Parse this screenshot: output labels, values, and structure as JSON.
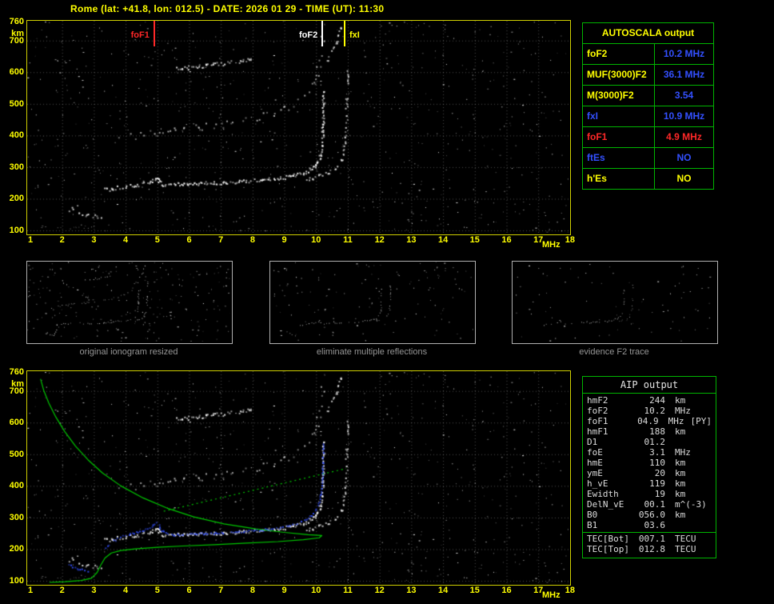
{
  "colors": {
    "yellow": "#ffff00",
    "green": "#00b400",
    "red": "#ff2828",
    "blue": "#3350ff",
    "white": "#ffffff"
  },
  "header": {
    "title": "Rome (lat: +41.8, lon: 012.5) - DATE: 2026 01 29 - TIME (UT): 11:30"
  },
  "top_plot": {
    "y_unit": "km",
    "x_unit": "MHz",
    "y_ticks": [
      760,
      700,
      600,
      500,
      400,
      300,
      200,
      100
    ],
    "x_ticks": [
      1,
      2,
      3,
      4,
      5,
      6,
      7,
      8,
      9,
      10,
      11,
      12,
      13,
      14,
      15,
      16,
      17,
      18
    ],
    "markers": [
      {
        "label": "foF1",
        "freq": 4.9,
        "color": "#ff2828",
        "side": "left"
      },
      {
        "label": "foF2",
        "freq": 10.2,
        "color": "#ffffff",
        "side": "left"
      },
      {
        "label": "fxI",
        "freq": 10.9,
        "color": "#ffff00",
        "side": "right"
      }
    ]
  },
  "bottom_plot": {
    "y_unit": "km",
    "x_unit": "MHz",
    "y_ticks": [
      760,
      700,
      600,
      500,
      400,
      300,
      200,
      100
    ],
    "x_ticks": [
      1,
      2,
      3,
      4,
      5,
      6,
      7,
      8,
      9,
      10,
      11,
      12,
      13,
      14,
      15,
      16,
      17,
      18
    ]
  },
  "autoscala_table": {
    "title": "AUTOSCALA output",
    "rows": [
      {
        "param": "foF2",
        "value": "10.2 MHz",
        "param_color": "yellow",
        "value_color": "blue"
      },
      {
        "param": "MUF(3000)F2",
        "value": "36.1 MHz",
        "param_color": "yellow",
        "value_color": "blue"
      },
      {
        "param": "M(3000)F2",
        "value": "3.54",
        "param_color": "yellow",
        "value_color": "blue"
      },
      {
        "param": "fxI",
        "value": "10.9 MHz",
        "param_color": "blue",
        "value_color": "blue"
      },
      {
        "param": "foF1",
        "value": "4.9 MHz",
        "param_color": "red",
        "value_color": "red"
      },
      {
        "param": "ftEs",
        "value": "NO",
        "param_color": "blue",
        "value_color": "blue"
      },
      {
        "param": "h'Es",
        "value": "NO",
        "param_color": "yellow",
        "value_color": "yellow"
      }
    ]
  },
  "thumbnails": [
    {
      "caption": "original ionogram resized"
    },
    {
      "caption": "eliminate multiple reflections"
    },
    {
      "caption": "evidence F2 trace"
    }
  ],
  "aip_table": {
    "title": "AIP output",
    "rows": [
      {
        "param": "hmF2",
        "value": "244",
        "unit": "km",
        "note": ""
      },
      {
        "param": "foF2",
        "value": "10.2",
        "unit": "MHz",
        "note": ""
      },
      {
        "param": "foF1",
        "value": "04.9",
        "unit": "MHz",
        "note": "[PY]"
      },
      {
        "param": "hmF1",
        "value": "188",
        "unit": "km",
        "note": ""
      },
      {
        "param": "D1",
        "value": "01.2",
        "unit": "",
        "note": ""
      },
      {
        "param": "foE",
        "value": "3.1",
        "unit": "MHz",
        "note": ""
      },
      {
        "param": "hmE",
        "value": "110",
        "unit": "km",
        "note": ""
      },
      {
        "param": "ymE",
        "value": "20",
        "unit": "km",
        "note": ""
      },
      {
        "param": "h_vE",
        "value": "119",
        "unit": "km",
        "note": ""
      },
      {
        "param": "Ewidth",
        "value": "19",
        "unit": "km",
        "note": ""
      },
      {
        "param": "DelN_vE",
        "value": "00.1",
        "unit": "m^(-3)",
        "note": ""
      },
      {
        "param": "B0",
        "value": "056.0",
        "unit": "km",
        "note": ""
      },
      {
        "param": "B1",
        "value": "03.6",
        "unit": "",
        "note": ""
      }
    ],
    "tec_rows": [
      {
        "param": "TEC[Bot]",
        "value": "007.1",
        "unit": "TECU",
        "note": ""
      },
      {
        "param": "TEC[Top]",
        "value": "012.8",
        "unit": "TECU",
        "note": ""
      }
    ]
  },
  "chart_data": [
    {
      "type": "scatter",
      "title": "vertical incidence ionogram",
      "xlabel": "MHz",
      "ylabel": "km",
      "xlim": [
        1,
        18
      ],
      "ylim": [
        100,
        760
      ],
      "grid": true,
      "markers": {
        "foF1": 4.9,
        "foF2": 10.2,
        "fxI": 10.9
      },
      "series": [
        {
          "name": "e_trace",
          "points": [
            [
              1.7,
              107
            ],
            [
              2.1,
              109
            ],
            [
              2.5,
              111
            ],
            [
              2.9,
              112
            ],
            [
              3.3,
              113
            ]
          ]
        },
        {
          "name": "o_trace_low",
          "points": [
            [
              2.25,
              170
            ],
            [
              2.5,
              160
            ],
            [
              2.8,
              150
            ],
            [
              3.05,
              144
            ],
            [
              3.25,
              140
            ]
          ]
        },
        {
          "name": "o_trace_F",
          "points": [
            [
              3.35,
              230
            ],
            [
              3.7,
              237
            ],
            [
              4.1,
              242
            ],
            [
              4.5,
              248
            ],
            [
              4.75,
              255
            ],
            [
              4.9,
              264
            ],
            [
              5.0,
              270
            ],
            [
              5.1,
              248
            ],
            [
              5.4,
              246
            ],
            [
              5.8,
              248
            ],
            [
              6.3,
              250
            ],
            [
              6.8,
              252
            ],
            [
              7.3,
              254
            ],
            [
              7.8,
              257
            ],
            [
              8.3,
              261
            ],
            [
              8.8,
              266
            ],
            [
              9.2,
              273
            ],
            [
              9.5,
              281
            ],
            [
              9.75,
              291
            ],
            [
              9.95,
              305
            ],
            [
              10.08,
              324
            ],
            [
              10.15,
              350
            ],
            [
              10.18,
              385
            ],
            [
              10.2,
              425
            ],
            [
              10.21,
              470
            ],
            [
              10.22,
              515
            ],
            [
              10.22,
              550
            ]
          ]
        },
        {
          "name": "x_trace",
          "points": [
            [
              9.7,
              263
            ],
            [
              10.0,
              270
            ],
            [
              10.25,
              279
            ],
            [
              10.5,
              291
            ],
            [
              10.68,
              307
            ],
            [
              10.8,
              330
            ],
            [
              10.88,
              362
            ],
            [
              10.92,
              405
            ],
            [
              10.94,
              455
            ],
            [
              10.95,
              510
            ],
            [
              10.96,
              565
            ],
            [
              10.96,
              610
            ]
          ]
        },
        {
          "name": "second_hop",
          "points": [
            [
              3.5,
              392
            ],
            [
              4.1,
              400
            ],
            [
              4.7,
              408
            ],
            [
              5.3,
              415
            ],
            [
              5.9,
              422
            ],
            [
              6.5,
              430
            ],
            [
              7.1,
              439
            ],
            [
              7.7,
              450
            ],
            [
              8.3,
              463
            ],
            [
              8.8,
              478
            ],
            [
              9.2,
              496
            ],
            [
              9.5,
              517
            ],
            [
              9.75,
              542
            ],
            [
              9.92,
              572
            ],
            [
              10.05,
              608
            ],
            [
              10.13,
              650
            ],
            [
              10.18,
              700
            ],
            [
              10.21,
              748
            ]
          ]
        },
        {
          "name": "high_arc",
          "points": [
            [
              5.6,
              612
            ],
            [
              6.1,
              618
            ],
            [
              6.6,
              624
            ],
            [
              7.1,
              630
            ],
            [
              7.6,
              637
            ],
            [
              8.0,
              644
            ]
          ]
        },
        {
          "name": "x_second_hop",
          "points": [
            [
              10.35,
              640
            ],
            [
              10.5,
              665
            ],
            [
              10.62,
              695
            ],
            [
              10.72,
              725
            ],
            [
              10.8,
              752
            ]
          ]
        }
      ]
    },
    {
      "type": "scatter",
      "title": "ionogram with AIP electron density profile",
      "xlabel": "MHz",
      "ylabel": "km",
      "xlim": [
        1,
        18
      ],
      "ylim": [
        100,
        760
      ],
      "grid": true,
      "series": [
        {
          "name": "electron_density_profile",
          "color": "#00c800",
          "points": [
            [
              1.32,
              738
            ],
            [
              1.42,
              702
            ],
            [
              1.58,
              662
            ],
            [
              1.8,
              618
            ],
            [
              2.08,
              572
            ],
            [
              2.42,
              526
            ],
            [
              2.82,
              482
            ],
            [
              3.28,
              440
            ],
            [
              3.85,
              400
            ],
            [
              4.55,
              362
            ],
            [
              5.3,
              330
            ],
            [
              6.15,
              302
            ],
            [
              7.1,
              280
            ],
            [
              8.1,
              264
            ],
            [
              9.0,
              253
            ],
            [
              9.75,
              246
            ],
            [
              10.18,
              243
            ],
            [
              10.1,
              236
            ],
            [
              9.6,
              230
            ],
            [
              8.8,
              224
            ],
            [
              7.8,
              219
            ],
            [
              6.8,
              214
            ],
            [
              5.8,
              210
            ],
            [
              5.0,
              206
            ],
            [
              4.3,
              201
            ],
            [
              3.85,
              196
            ],
            [
              3.55,
              188
            ],
            [
              3.35,
              172
            ],
            [
              3.22,
              150
            ],
            [
              3.1,
              126
            ],
            [
              2.92,
              108
            ],
            [
              2.6,
              101
            ],
            [
              2.1,
              97
            ],
            [
              1.6,
              95
            ]
          ]
        },
        {
          "name": "profile_extension",
          "color": "#00c800",
          "points": [
            [
              5.2,
              320
            ],
            [
              10.95,
              455
            ]
          ]
        },
        {
          "name": "scaled_trace",
          "color": "#3350ff",
          "points": [
            [
              2.2,
              152
            ],
            [
              2.5,
              140
            ],
            [
              2.8,
              130
            ],
            [
              3.0,
              122
            ],
            [
              3.35,
              205
            ],
            [
              3.6,
              228
            ],
            [
              3.9,
              242
            ],
            [
              4.2,
              251
            ],
            [
              4.5,
              259
            ],
            [
              4.75,
              270
            ],
            [
              4.9,
              282
            ],
            [
              5.0,
              290
            ],
            [
              5.1,
              262
            ],
            [
              5.3,
              250
            ],
            [
              5.6,
              247
            ],
            [
              6.0,
              249
            ],
            [
              6.5,
              251
            ],
            [
              7.0,
              253
            ],
            [
              7.5,
              256
            ],
            [
              8.0,
              260
            ],
            [
              8.5,
              265
            ],
            [
              9.0,
              272
            ],
            [
              9.4,
              282
            ],
            [
              9.7,
              296
            ],
            [
              9.9,
              314
            ],
            [
              10.02,
              334
            ],
            [
              10.1,
              360
            ],
            [
              10.15,
              392
            ],
            [
              10.18,
              428
            ],
            [
              10.2,
              465
            ],
            [
              10.21,
              505
            ],
            [
              10.22,
              540
            ]
          ]
        }
      ]
    }
  ]
}
